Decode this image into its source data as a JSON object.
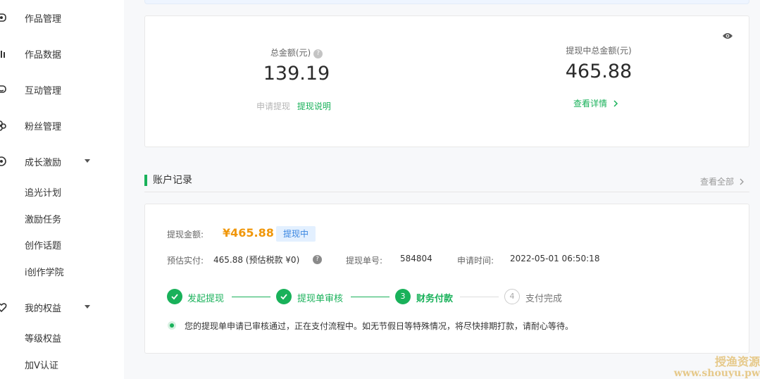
{
  "sidebar": {
    "items": [
      {
        "label": "作品管理",
        "icon": "eye-frame-icon"
      },
      {
        "label": "作品数据",
        "icon": "bar-chart-icon"
      },
      {
        "label": "互动管理",
        "icon": "chat-icon"
      },
      {
        "label": "粉丝管理",
        "icon": "users-icon"
      },
      {
        "label": "成长激励",
        "icon": "growth-icon"
      },
      {
        "label": "我的权益",
        "icon": "heart-shield-icon"
      }
    ],
    "growth_sub": [
      "追光计划",
      "激励任务",
      "创作话题",
      "i创作学院"
    ],
    "rights_sub": [
      "等级权益",
      "加V认证"
    ]
  },
  "summary": {
    "total_label": "总金额(元)",
    "total_value": "139.19",
    "apply_withdraw": "申请提现",
    "withdraw_help": "提现说明",
    "pending_label": "提现中总金额(元)",
    "pending_value": "465.88",
    "view_detail": "查看详情"
  },
  "records": {
    "title": "账户记录",
    "view_all": "查看全部",
    "amount_label": "提现金额:",
    "amount_value": "¥465.88",
    "status_badge": "提现中",
    "est_label": "预估实付:",
    "est_value": "465.88 (预估税款 ¥0)",
    "order_label": "提现单号:",
    "order_value": "584804",
    "time_label": "申请时间:",
    "time_value": "2022-05-01 06:50:18",
    "steps": [
      {
        "label": "发起提现",
        "state": "done"
      },
      {
        "label": "提现单审核",
        "state": "done"
      },
      {
        "label": "财务付款",
        "state": "active",
        "num": "3"
      },
      {
        "label": "支付完成",
        "state": "pending",
        "num": "4"
      }
    ],
    "notice": "您的提现单申请已审核通过，正在支付流程中。如无节假日等特殊情况，将尽快排期打款，请耐心等待。"
  },
  "watermark": {
    "line1": "授渔资源",
    "line2": "www.shouyu.pw"
  },
  "colors": {
    "accent": "#19b15a",
    "amount": "#f0970a",
    "badge_bg": "#e3f0ff",
    "badge_text": "#3a86e0"
  }
}
